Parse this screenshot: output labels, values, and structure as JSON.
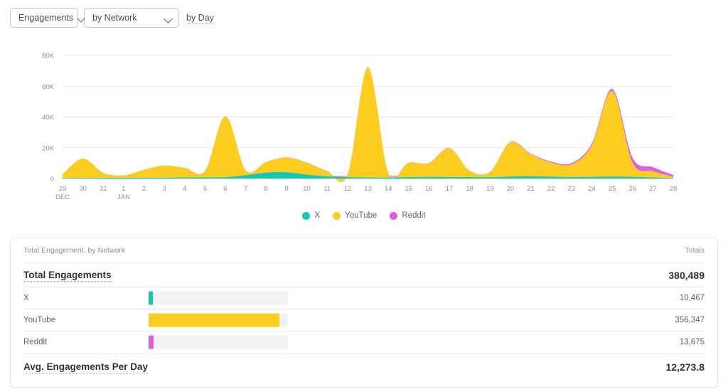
{
  "toolbar": {
    "metric_select": {
      "value": "Engagements",
      "icon": "chevron-down-icon"
    },
    "dimension_select": {
      "value": "by Network",
      "icon": "chevron-down-icon"
    },
    "interval_link": "by Day"
  },
  "legend": {
    "items": [
      {
        "label": "X",
        "color": "#12c9b0"
      },
      {
        "label": "YouTube",
        "color": "#fccd1e"
      },
      {
        "label": "Reddit",
        "color": "#db5fe0"
      }
    ]
  },
  "chart_data": {
    "type": "area",
    "title": "",
    "xlabel": "",
    "ylabel": "",
    "stacked": true,
    "grid": true,
    "legend_position": "bottom",
    "ylim": [
      0,
      80000
    ],
    "yticks": [
      0,
      20000,
      40000,
      60000,
      80000
    ],
    "ytick_labels": [
      "0",
      "20K",
      "40K",
      "60K",
      "80K"
    ],
    "categories": [
      "29",
      "30",
      "31",
      "1",
      "2",
      "3",
      "4",
      "5",
      "6",
      "7",
      "8",
      "9",
      "10",
      "11",
      "12",
      "13",
      "14",
      "15",
      "16",
      "17",
      "18",
      "19",
      "20",
      "21",
      "22",
      "23",
      "24",
      "25",
      "26",
      "27",
      "28"
    ],
    "month_markers": [
      {
        "index": 0,
        "label": "DEC"
      },
      {
        "index": 3,
        "label": "JAN"
      }
    ],
    "series": [
      {
        "name": "X",
        "color": "#12c9b0",
        "values": [
          300,
          350,
          400,
          450,
          500,
          600,
          700,
          800,
          900,
          2200,
          3900,
          4100,
          2600,
          1400,
          900,
          700,
          650,
          900,
          1100,
          1000,
          900,
          850,
          1300,
          1500,
          1200,
          1000,
          1100,
          1300,
          1100,
          700,
          300
        ]
      },
      {
        "name": "YouTube",
        "color": "#fccd1e",
        "values": [
          2500,
          12600,
          3200,
          1600,
          5200,
          7800,
          6200,
          4200,
          39500,
          3000,
          6800,
          9500,
          7600,
          3400,
          1500,
          71500,
          3000,
          9300,
          8900,
          18800,
          4100,
          3300,
          22300,
          14200,
          9200,
          8200,
          20500,
          55500,
          9200,
          4100,
          900
        ]
      },
      {
        "name": "Reddit",
        "color": "#db5fe0",
        "values": [
          60,
          70,
          70,
          70,
          80,
          90,
          100,
          110,
          120,
          110,
          120,
          130,
          130,
          120,
          110,
          140,
          120,
          130,
          140,
          160,
          170,
          200,
          300,
          450,
          600,
          800,
          1100,
          1400,
          3200,
          2600,
          1100
        ]
      }
    ]
  },
  "table": {
    "caption": "Total Engagement, by Network",
    "totals_header": "Totals",
    "total_row": {
      "label": "Total Engagements",
      "value": "380,489"
    },
    "rows": [
      {
        "label": "X",
        "value": "10,467",
        "color": "#12c9b0",
        "pct": 2.9
      },
      {
        "label": "YouTube",
        "value": "356,347",
        "color": "#fccd1e",
        "pct": 94.0
      },
      {
        "label": "Reddit",
        "value": "13,675",
        "color": "#db5fe0",
        "pct": 3.8
      }
    ],
    "avg_row": {
      "label": "Avg. Engagements Per Day",
      "value": "12,273.8"
    }
  }
}
